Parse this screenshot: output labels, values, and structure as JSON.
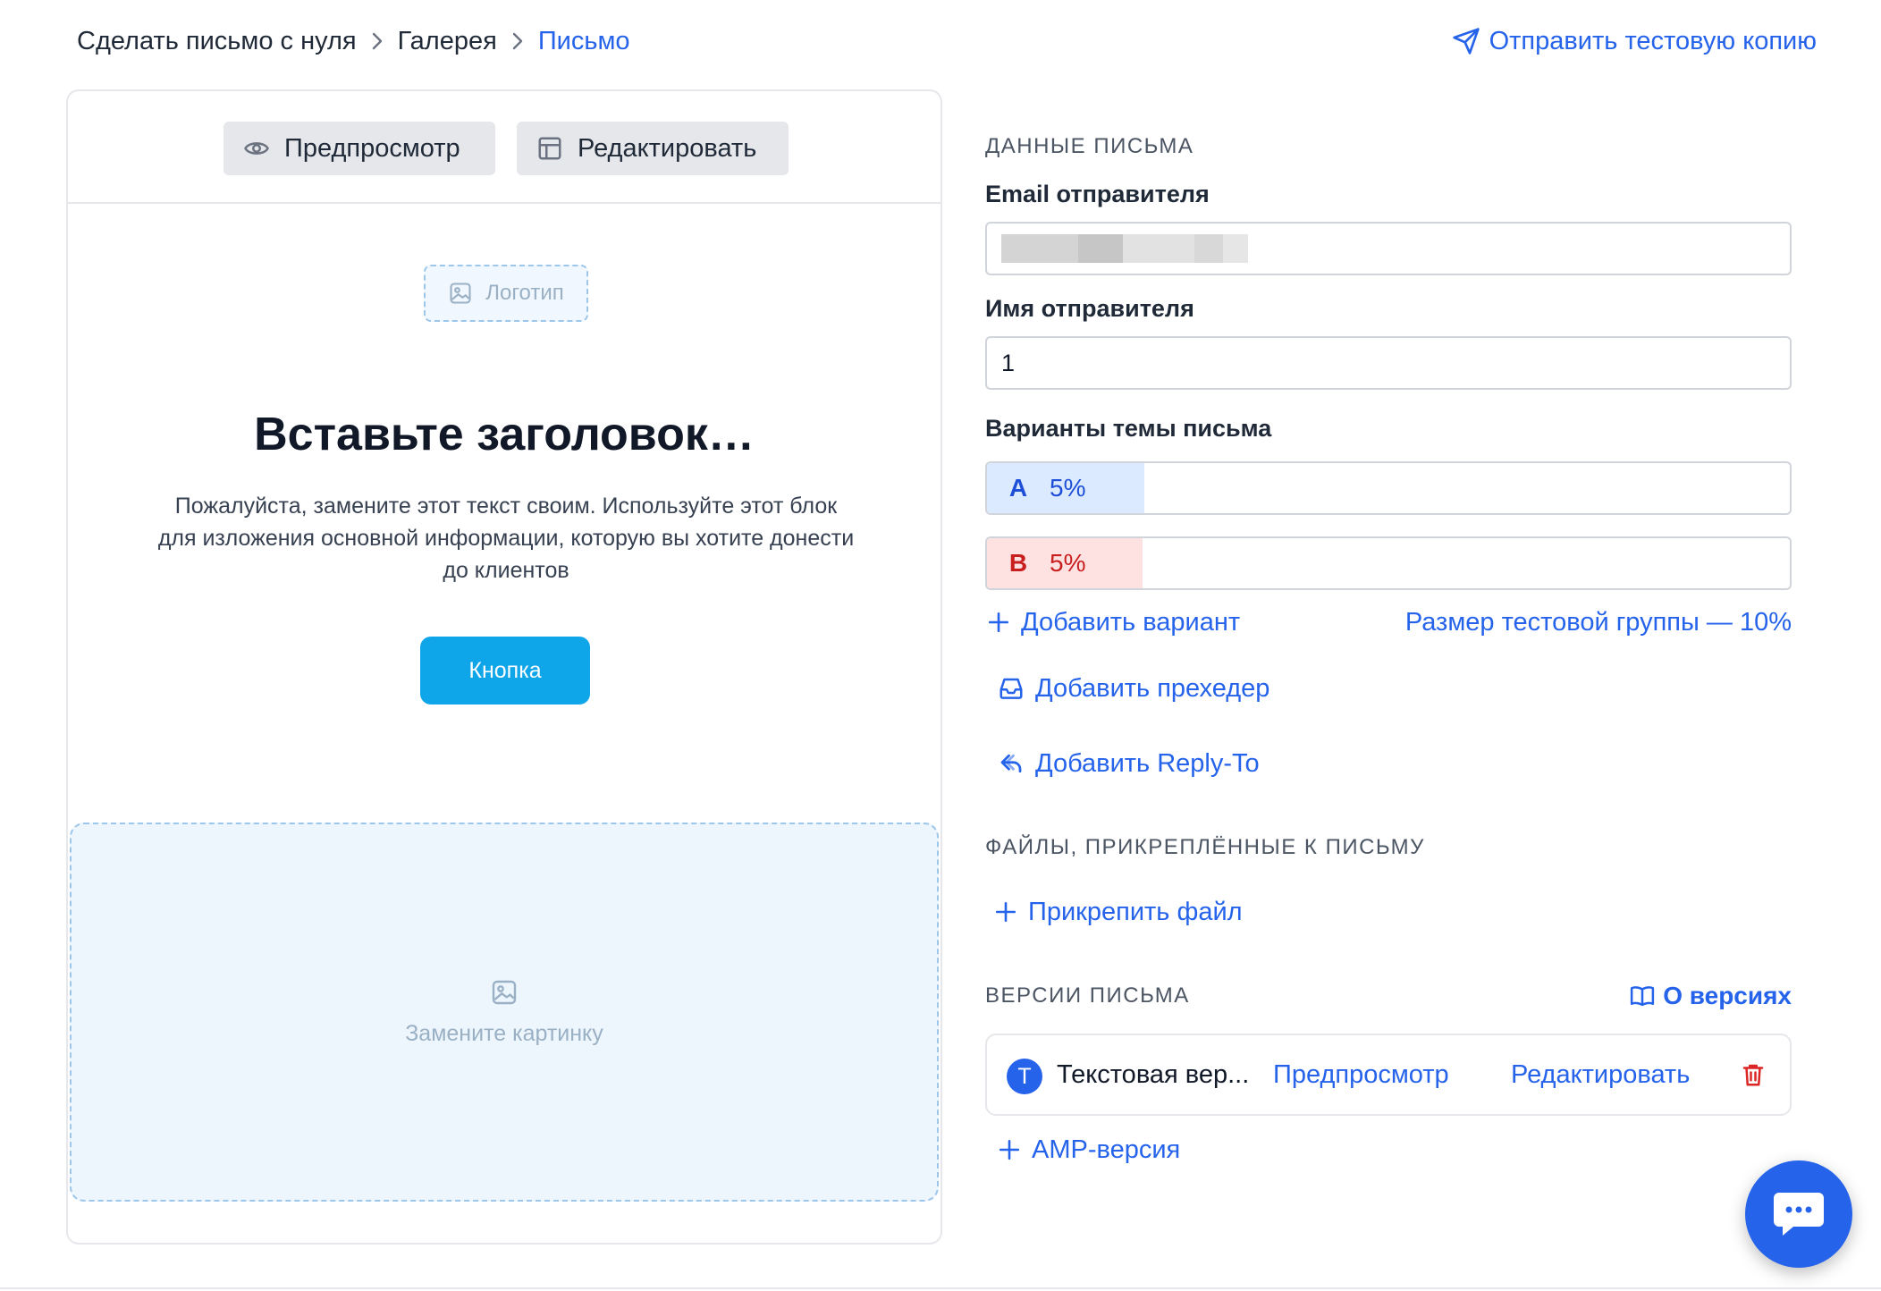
{
  "breadcrumb": {
    "items": [
      "Сделать письмо с нуля",
      "Галерея"
    ],
    "current": "Письмо"
  },
  "header": {
    "send_test_label": "Отправить тестовую копию"
  },
  "editor": {
    "preview_label": "Предпросмотр",
    "edit_label": "Редактировать",
    "logo_placeholder": "Логотип",
    "title": "Вставьте заголовок…",
    "body_text": "Пожалуйста, замените этот текст своим. Используйте этот блок для изложения основной информации, которую вы хотите донести до клиентов",
    "button_label": "Кнопка",
    "image_placeholder": "Замените картинку"
  },
  "letter": {
    "section_title": "ДАННЫЕ ПИСЬМА",
    "sender_email_label": "Email отправителя",
    "sender_name_label": "Имя отправителя",
    "sender_name_value": "1",
    "subject_variants_label": "Варианты темы письма",
    "variants": [
      {
        "letter": "A",
        "percent": "5%"
      },
      {
        "letter": "B",
        "percent": "5%"
      }
    ],
    "add_variant_label": "Добавить вариант",
    "test_group_label": "Размер тестовой группы — 10%",
    "add_preheader_label": "Добавить прехедер",
    "add_reply_to_label": "Добавить Reply-To"
  },
  "files": {
    "section_title": "ФАЙЛЫ, ПРИКРЕПЛЁННЫЕ К ПИСЬМУ",
    "attach_label": "Прикрепить файл"
  },
  "versions": {
    "section_title": "ВЕРСИИ ПИСЬМА",
    "about_label": "О версиях",
    "items": [
      {
        "avatar": "Т",
        "name": "Текстовая вер...",
        "preview": "Предпросмотр",
        "edit": "Редактировать"
      }
    ],
    "amp_label": "AMP-версия"
  },
  "colors": {
    "accent": "#2563eb",
    "email_button": "#0ea5e9",
    "variant_a_bg": "#dbeafe",
    "variant_b_bg": "#fee2e2",
    "delete": "#dc2626"
  },
  "icons": [
    "send-icon",
    "chevron-right-icon",
    "eye-icon",
    "layout-icon",
    "image-icon",
    "plus-icon",
    "inbox-icon",
    "reply-icon",
    "book-icon",
    "trash-icon",
    "chat-icon"
  ]
}
